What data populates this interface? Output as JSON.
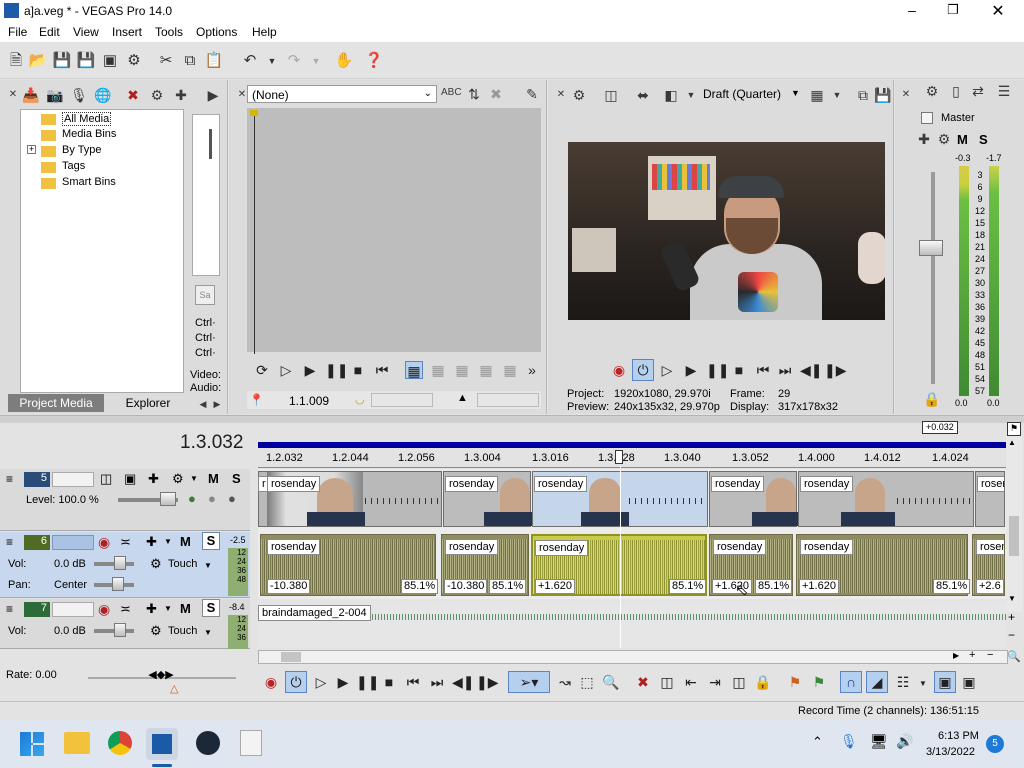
{
  "window": {
    "title": "a]a.veg * - VEGAS Pro 14.0"
  },
  "menu": [
    "File",
    "Edit",
    "View",
    "Insert",
    "Tools",
    "Options",
    "Help"
  ],
  "project_media": {
    "tree": [
      "All Media",
      "Media Bins",
      "By Type",
      "Tags",
      "Smart Bins"
    ],
    "expand": "+",
    "tabs": [
      "Project Media",
      "Explorer"
    ],
    "side_labels": [
      "Ctrl·",
      "Ctrl·",
      "Ctrl·",
      "Video:",
      "Audio:"
    ]
  },
  "trimmer": {
    "dropdown": "(None)",
    "time": "1.1.009"
  },
  "preview": {
    "quality": "Draft (Quarter)",
    "project_label": "Project:",
    "project_value": "1920x1080, 29.970i",
    "preview_label": "Preview:",
    "preview_value": "240x135x32, 29.970p",
    "frame_label": "Frame:",
    "frame_value": "29",
    "display_label": "Display:",
    "display_value": "317x178x32"
  },
  "master": {
    "label": "Master",
    "peak_left": "-0.3",
    "peak_right": "-1.7",
    "scale": [
      "3",
      "6",
      "9",
      "12",
      "15",
      "18",
      "21",
      "24",
      "27",
      "30",
      "33",
      "36",
      "39",
      "42",
      "45",
      "48",
      "51",
      "54",
      "57"
    ],
    "bottom_left": "0.0",
    "bottom_right": "0.0",
    "m": "M",
    "s": "S"
  },
  "timeline": {
    "cursor_time": "1.3.032",
    "offset_badge": "+0.032",
    "ruler": [
      "1.2.032",
      "1.2.044",
      "1.2.056",
      "1.3.004",
      "1.3.016",
      "1.3.028",
      "1.3.040",
      "1.3.052",
      "1.4.000",
      "1.4.012",
      "1.4.024"
    ],
    "rate": "Rate: 0.00"
  },
  "tracks": [
    {
      "num": "5",
      "level_label": "Level: 100.0 %",
      "m": "M",
      "s": "S",
      "meter": "-2.5"
    },
    {
      "num": "6",
      "vol_label": "Vol:",
      "vol": "0.0 dB",
      "pan_label": "Pan:",
      "pan": "Center",
      "mode": "Touch",
      "m": "M",
      "s": "S",
      "meter_vals": [
        "12",
        "24",
        "36",
        "48"
      ]
    },
    {
      "num": "7",
      "vol_label": "Vol:",
      "vol": "0.0 dB",
      "mode": "Touch",
      "m": "M",
      "s": "S",
      "meter": "-8.4",
      "meter_vals": [
        "12",
        "24",
        "36"
      ]
    }
  ],
  "video_clips": [
    "r",
    "rosenday",
    "rosenday",
    "rosenday",
    "rosenday",
    "rosenday",
    "rosen"
  ],
  "audio_clips": [
    "rosenday",
    "rosenday",
    "rosenday",
    "rosenday",
    "rosenday",
    "rosen"
  ],
  "audio_values": [
    "-10.380",
    "85.1%",
    "-10.380",
    "85.1%",
    "+1.620",
    "85.1%",
    "+1.620",
    "85.1%",
    "+1.620",
    "85.1%",
    "+2.6"
  ],
  "track7_clip": "braindamaged_2-004",
  "status": {
    "record_time": "Record Time (2 channels): 136:51:15"
  },
  "taskbar": {
    "time": "6:13 PM",
    "date": "3/13/2022",
    "badge": "5"
  },
  "colors": {
    "track_selected": "#c7d8ee",
    "timeline_bar": "#0000a0",
    "selected_clip": "#c8cc4a"
  }
}
